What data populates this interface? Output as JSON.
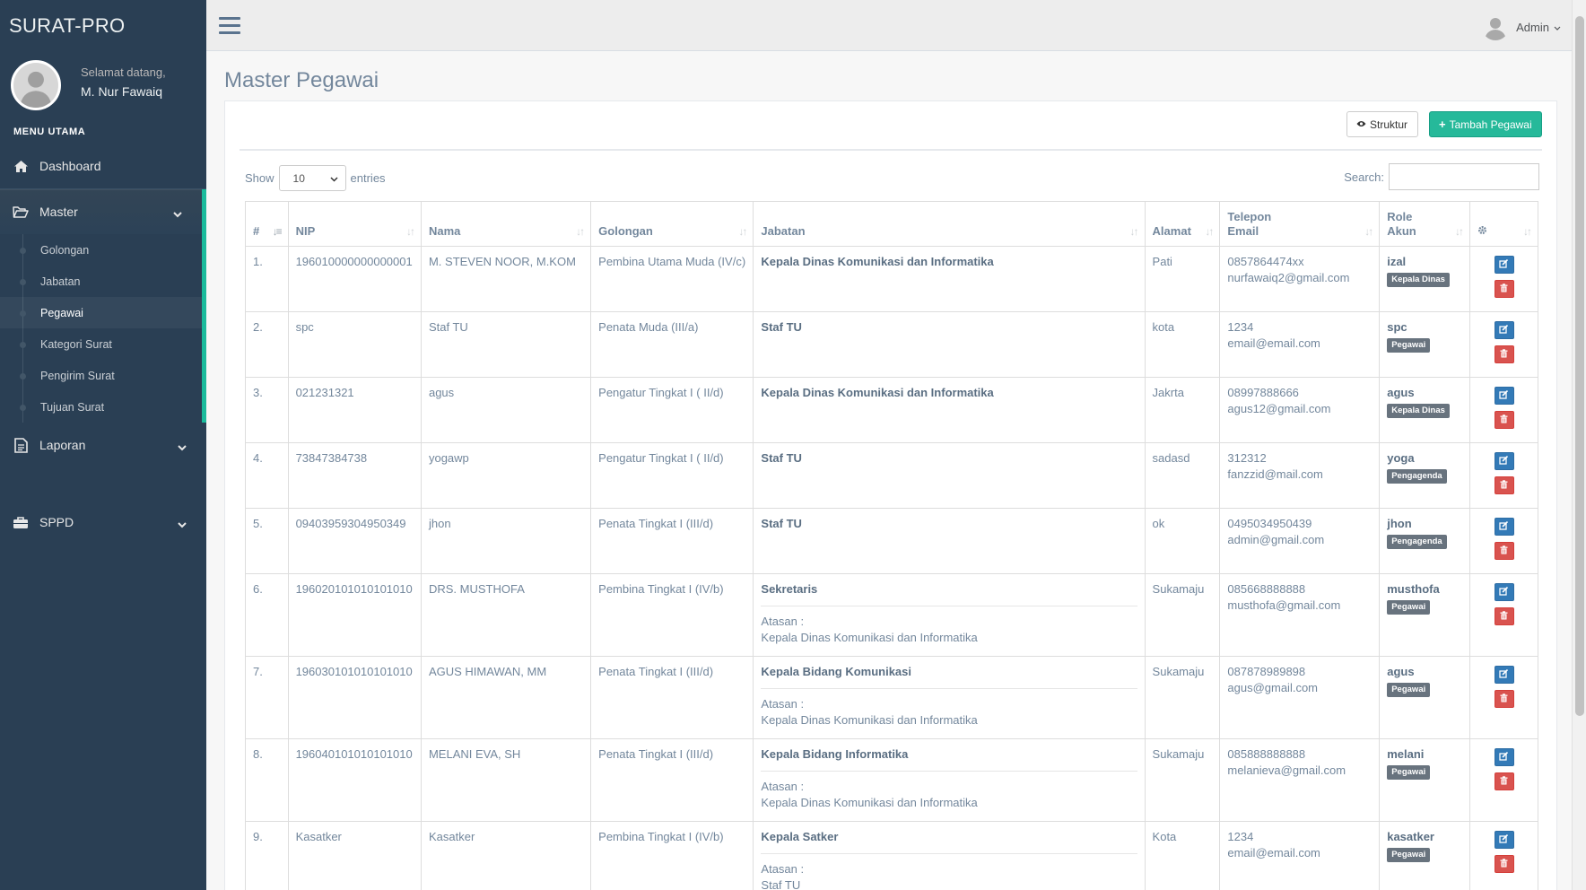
{
  "app": {
    "brand": "SURAT-PRO"
  },
  "profile": {
    "greeting": "Selamat datang,",
    "name": "M. Nur Fawaiq"
  },
  "sidebar": {
    "section_title": "MENU UTAMA",
    "dashboard": {
      "label": "Dashboard",
      "icon": "home-icon"
    },
    "master": {
      "label": "Master",
      "icon": "folder-open-icon",
      "items": [
        "Golongan",
        "Jabatan",
        "Pegawai",
        "Kategori Surat",
        "Pengirim Surat",
        "Tujuan Surat"
      ],
      "active": "Pegawai"
    },
    "laporan": {
      "label": "Laporan",
      "icon": "file-text-icon"
    },
    "sppd": {
      "label": "SPPD",
      "icon": "briefcase-icon"
    }
  },
  "topnav": {
    "user_label": "Admin"
  },
  "page": {
    "title": "Master Pegawai",
    "btn_struktur": "Struktur",
    "btn_tambah": "Tambah Pegawai"
  },
  "datatable": {
    "show_label": "Show",
    "entries_label": "entries",
    "page_length": "10",
    "search_label": "Search:",
    "search_value": "",
    "columns": [
      "#",
      "NIP",
      "Nama",
      "Golongan",
      "Jabatan",
      "Alamat",
      "Telepon",
      "Email",
      "Role",
      "Akun",
      "settings-icon"
    ],
    "rows": [
      {
        "no": "1.",
        "nip": "196010000000000001",
        "nama": "M. STEVEN NOOR, M.KOM",
        "golongan": "Pembina Utama Muda (IV/c)",
        "jabatan": "Kepala Dinas Komunikasi dan Informatika",
        "atasan_label": "",
        "atasan": "",
        "alamat": "Pati",
        "telepon": "0857864474xx",
        "email": "nurfawaiq2@gmail.com",
        "akun": "izal",
        "role": "Kepala Dinas"
      },
      {
        "no": "2.",
        "nip": "spc",
        "nama": "Staf TU",
        "golongan": "Penata Muda (III/a)",
        "jabatan": "Staf TU",
        "atasan_label": "",
        "atasan": "",
        "alamat": "kota",
        "telepon": "1234",
        "email": "email@email.com",
        "akun": "spc",
        "role": "Pegawai"
      },
      {
        "no": "3.",
        "nip": "021231321",
        "nama": "agus",
        "golongan": "Pengatur Tingkat I ( II/d)",
        "jabatan": "Kepala Dinas Komunikasi dan Informatika",
        "atasan_label": "",
        "atasan": "",
        "alamat": "Jakrta",
        "telepon": "08997888666",
        "email": "agus12@gmail.com",
        "akun": "agus",
        "role": "Kepala Dinas"
      },
      {
        "no": "4.",
        "nip": "73847384738",
        "nama": "yogawp",
        "golongan": "Pengatur Tingkat I ( II/d)",
        "jabatan": "Staf TU",
        "atasan_label": "",
        "atasan": "",
        "alamat": "sadasd",
        "telepon": "312312",
        "email": "fanzzid@mail.com",
        "akun": "yoga",
        "role": "Pengagenda"
      },
      {
        "no": "5.",
        "nip": "09403959304950349",
        "nama": "jhon",
        "golongan": "Penata Tingkat I (III/d)",
        "jabatan": "Staf TU",
        "atasan_label": "",
        "atasan": "",
        "alamat": "ok",
        "telepon": "0495034950439",
        "email": "admin@gmail.com",
        "akun": "jhon",
        "role": "Pengagenda"
      },
      {
        "no": "6.",
        "nip": "196020101010101010",
        "nama": "DRS. MUSTHOFA",
        "golongan": "Pembina Tingkat I (IV/b)",
        "jabatan": "Sekretaris",
        "atasan_label": "Atasan :",
        "atasan": "Kepala Dinas Komunikasi dan Informatika",
        "alamat": "Sukamaju",
        "telepon": "085668888888",
        "email": "musthofa@gmail.com",
        "akun": "musthofa",
        "role": "Pegawai"
      },
      {
        "no": "7.",
        "nip": "196030101010101010",
        "nama": "AGUS HIMAWAN, MM",
        "golongan": "Penata Tingkat I (III/d)",
        "jabatan": "Kepala Bidang Komunikasi",
        "atasan_label": "Atasan :",
        "atasan": "Kepala Dinas Komunikasi dan Informatika",
        "alamat": "Sukamaju",
        "telepon": "087878989898",
        "email": "agus@gmail.com",
        "akun": "agus",
        "role": "Pegawai"
      },
      {
        "no": "8.",
        "nip": "196040101010101010",
        "nama": "MELANI EVA, SH",
        "golongan": "Penata Tingkat I (III/d)",
        "jabatan": "Kepala Bidang Informatika",
        "atasan_label": "Atasan :",
        "atasan": "Kepala Dinas Komunikasi dan Informatika",
        "alamat": "Sukamaju",
        "telepon": "085888888888",
        "email": "melanieva@gmail.com",
        "akun": "melani",
        "role": "Pegawai"
      },
      {
        "no": "9.",
        "nip": "Kasatker",
        "nama": "Kasatker",
        "golongan": "Pembina Tingkat I (IV/b)",
        "jabatan": "Kepala Satker",
        "atasan_label": "Atasan :",
        "atasan": "Staf TU",
        "alamat": "Kota",
        "telepon": "1234",
        "email": "email@email.com",
        "akun": "kasatker",
        "role": "Pegawai"
      }
    ]
  },
  "colors": {
    "sidebar": "#2A3F54",
    "accent": "#1ABB9C",
    "success": "#26B99A",
    "edit": "#337AB7",
    "delete": "#D9534F"
  }
}
